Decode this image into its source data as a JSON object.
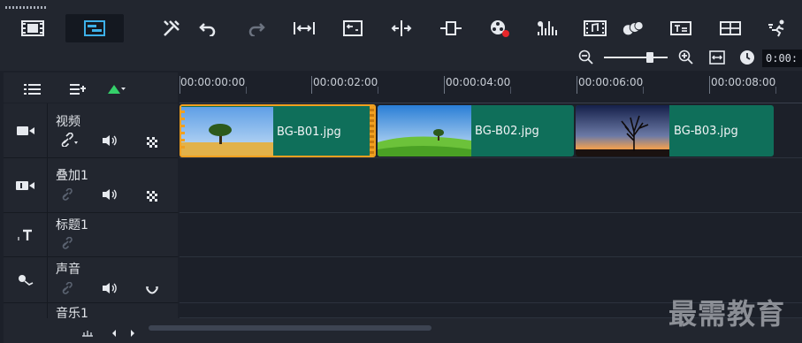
{
  "toolbar": {
    "buttons": [
      {
        "name": "storyboard-view-icon"
      },
      {
        "name": "timeline-view-icon"
      },
      {
        "name": "tools-icon"
      },
      {
        "name": "undo-icon"
      },
      {
        "name": "redo-icon"
      },
      {
        "name": "fit-project-icon"
      },
      {
        "name": "trim-icon"
      },
      {
        "name": "split-icon"
      },
      {
        "name": "track-transition-icon"
      },
      {
        "name": "record-capture-icon"
      },
      {
        "name": "audio-mixer-icon"
      },
      {
        "name": "auto-music-icon"
      },
      {
        "name": "motion-track-icon"
      },
      {
        "name": "subtitle-editor-icon"
      },
      {
        "name": "multi-camera-icon"
      },
      {
        "name": "time-remap-icon"
      }
    ],
    "zoom_level": 0.72,
    "timecode": "0:00:"
  },
  "track_header": {
    "controls": [
      "track-manager-icon",
      "chapter-cue-icon",
      "ripple-edit-icon"
    ]
  },
  "ruler": {
    "ticks": [
      "00:00:00:00",
      "00:00:02:00",
      "00:00:04:00",
      "00:00:06:00",
      "00:00:08:00"
    ]
  },
  "tracks": [
    {
      "id": "video",
      "label": "视频"
    },
    {
      "id": "overlay",
      "label": "叠加1"
    },
    {
      "id": "title",
      "label": "标题1"
    },
    {
      "id": "voice",
      "label": "声音"
    },
    {
      "id": "music",
      "label": "音乐1"
    }
  ],
  "clips": [
    {
      "label": "BG-B01.jpg",
      "selected": true
    },
    {
      "label": "BG-B02.jpg",
      "selected": false
    },
    {
      "label": "BG-B03.jpg",
      "selected": false
    }
  ],
  "watermark": "最需教育",
  "colors": {
    "clip": "#0f6f5a",
    "selection": "#f0a020",
    "accent": "#3db0e8",
    "ripple": "#35d06a"
  }
}
